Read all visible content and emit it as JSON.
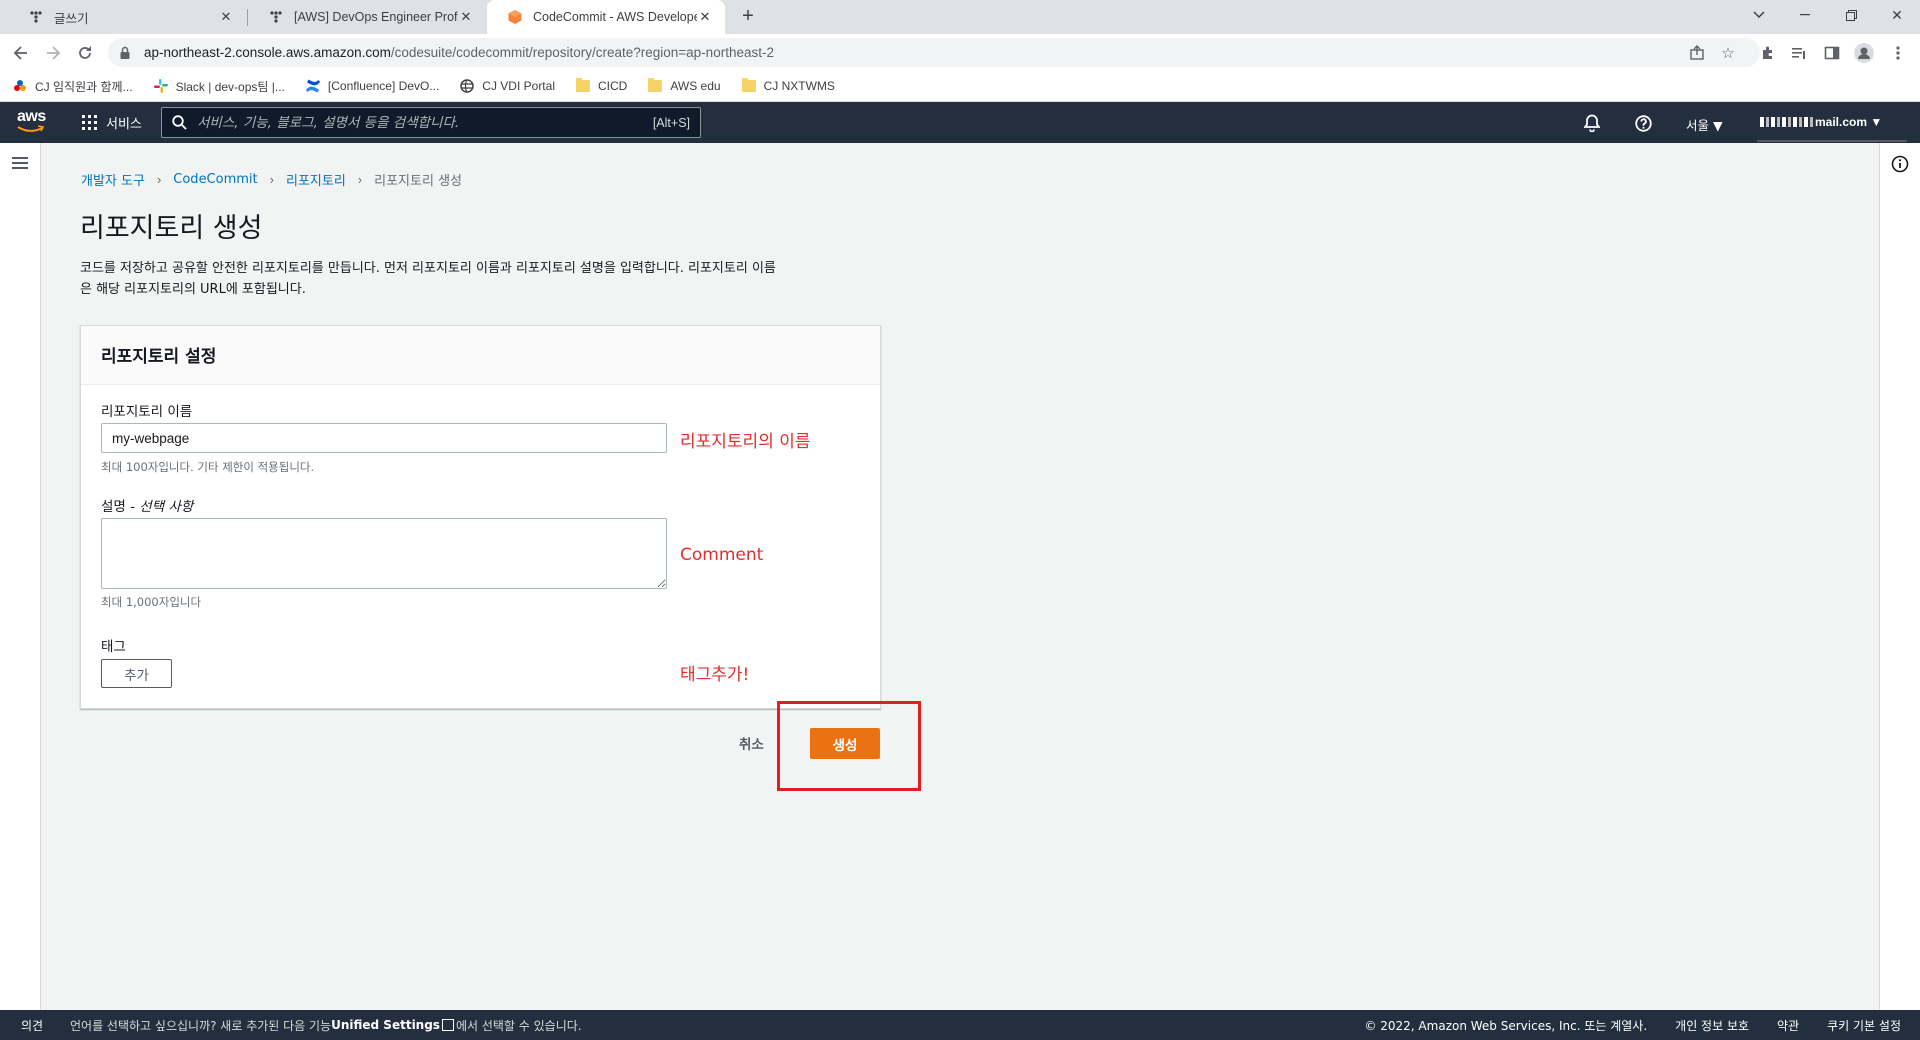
{
  "browser": {
    "tabs": [
      {
        "title": "글쓰기"
      },
      {
        "title": "[AWS] DevOps Engineer Profess"
      },
      {
        "title": "CodeCommit - AWS Developer"
      }
    ],
    "url_host": "ap-northeast-2.console.aws.amazon.com",
    "url_path": "/codesuite/codecommit/repository/create?region=ap-northeast-2",
    "bookmarks": [
      {
        "label": "CJ 임직원과 함께..."
      },
      {
        "label": "Slack | dev-ops팀 |..."
      },
      {
        "label": "[Confluence] DevO..."
      },
      {
        "label": "CJ VDI Portal"
      },
      {
        "label": "CICD"
      },
      {
        "label": "AWS edu"
      },
      {
        "label": "CJ NXTWMS"
      }
    ]
  },
  "aws_header": {
    "logo_text": "aws",
    "services_label": "서비스",
    "search_placeholder": "서비스, 기능, 블로그, 설명서 등을 검색합니다.",
    "search_shortcut": "[Alt+S]",
    "region": "서울 ▼",
    "account": "mail.com ▼"
  },
  "breadcrumb": {
    "items": [
      "개발자 도구",
      "CodeCommit",
      "리포지토리"
    ],
    "current": "리포지토리 생성"
  },
  "page": {
    "title": "리포지토리 생성",
    "description_line1": "코드를 저장하고 공유할 안전한 리포지토리를 만듭니다. 먼저 리포지토리 이름과 리포지토리 설명을 입력합니다. 리포지토리 이름",
    "description_line2": "은 해당 리포지토리의 URL에 포함됩니다."
  },
  "settings_panel": {
    "header": "리포지토리 설정",
    "name_label": "리포지토리 이름",
    "name_value": "my-webpage",
    "name_hint": "최대 100자입니다. 기타 제한이 적용됩니다.",
    "desc_label": "설명 - ",
    "desc_optional": "선택 사항",
    "desc_value": "",
    "desc_hint": "최대 1,000자입니다",
    "tags_label": "태그",
    "add_button": "추가"
  },
  "annotations": {
    "name_note": "리포지토리의 이름",
    "comment_note": "Comment",
    "tag_note": "태그추가!"
  },
  "actions": {
    "cancel": "취소",
    "create": "생성"
  },
  "footer": {
    "feedback": "의견",
    "lang_prefix": "언어를 선택하고 싶으십니까? 새로 추가된 다음 기능",
    "lang_feature": "Unified Settings",
    "lang_suffix": "에서 선택할 수 있습니다.",
    "copyright": "© 2022, Amazon Web Services, Inc. 또는 계열사.",
    "privacy": "개인 정보 보호",
    "terms": "약관",
    "cookies": "쿠키 기본 설정"
  },
  "colors": {
    "aws_nav": "#232f3e",
    "primary_button": "#ec7211",
    "link": "#0073bb",
    "annotation": "#e42d2d"
  }
}
